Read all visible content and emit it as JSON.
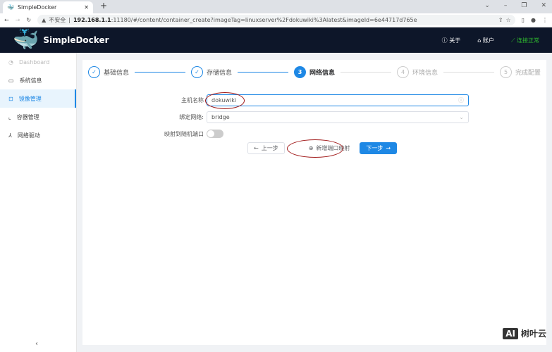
{
  "browser": {
    "tab_title": "SimpleDocker",
    "url_warning": "不安全",
    "url_host": "192.168.1.1",
    "url_rest": ":11180/#/content/container_create?imageTag=linuxserver%2Fdokuwiki%3Alatest&imageId=6e44717d765e"
  },
  "header": {
    "brand": "SimpleDocker",
    "about": "关于",
    "account": "账户",
    "status": "连接正常"
  },
  "sidebar": {
    "items": [
      {
        "label": "Dashboard"
      },
      {
        "label": "系统信息"
      },
      {
        "label": "镜像管理"
      },
      {
        "label": "容器管理"
      },
      {
        "label": "网络驱动"
      }
    ]
  },
  "steps": [
    {
      "num": "1",
      "label": "基础信息"
    },
    {
      "num": "2",
      "label": "存储信息"
    },
    {
      "num": "3",
      "label": "网络信息"
    },
    {
      "num": "4",
      "label": "环境信息"
    },
    {
      "num": "5",
      "label": "完成配置"
    }
  ],
  "form": {
    "hostname_label": "主机名称",
    "hostname_value": "dokuwiki",
    "network_label": "绑定网络:",
    "network_value": "bridge",
    "random_port_label": "映射到随机端口",
    "random_port_on": false
  },
  "buttons": {
    "prev": "上一步",
    "add_port": "新增端口映射",
    "next": "下一步"
  },
  "watermark": {
    "ai": "AI",
    "text": "树叶云"
  }
}
